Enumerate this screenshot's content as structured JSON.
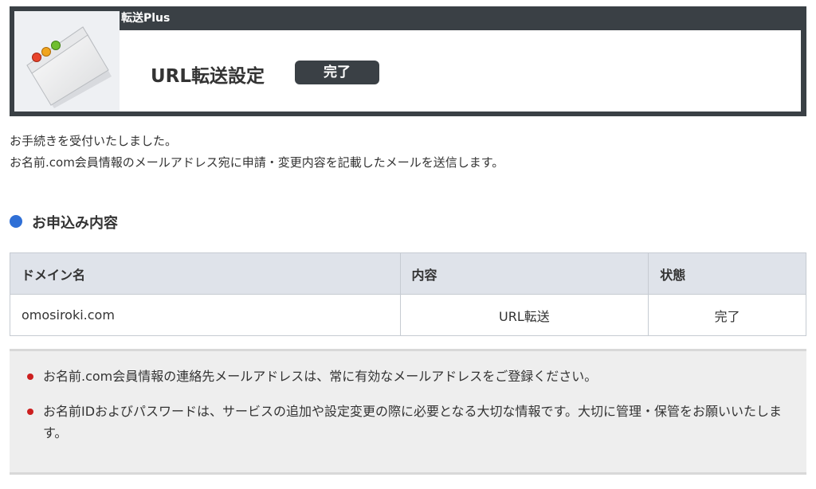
{
  "header": {
    "service_name": "転送Plus",
    "page_title": "URL転送設定",
    "status_label": "完了"
  },
  "messages": {
    "line1": "お手続きを受付いたしました。",
    "line2": "お名前.com会員情報のメールアドレス宛に申請・変更内容を記載したメールを送信します。"
  },
  "section": {
    "title": "お申込み内容"
  },
  "table": {
    "headers": [
      "ドメイン名",
      "内容",
      "状態"
    ],
    "rows": [
      [
        "omosiroki.com",
        "URL転送",
        "完了"
      ]
    ]
  },
  "notices": [
    "お名前.com会員情報の連絡先メールアドレスは、常に有効なメールアドレスをご登録ください。",
    "お名前IDおよびパスワードは、サービスの追加や設定変更の際に必要となる大切な情報です。大切に管理・保管をお願いいたします。"
  ],
  "colors": {
    "header_bg": "#3a4045",
    "accent_blue": "#2f6fd6",
    "bullet_red": "#cc1f1f",
    "table_header_bg": "#dfe3ea",
    "notice_bg": "#eeeeee"
  },
  "icons": {
    "header_icon": "browser-window-icon"
  }
}
